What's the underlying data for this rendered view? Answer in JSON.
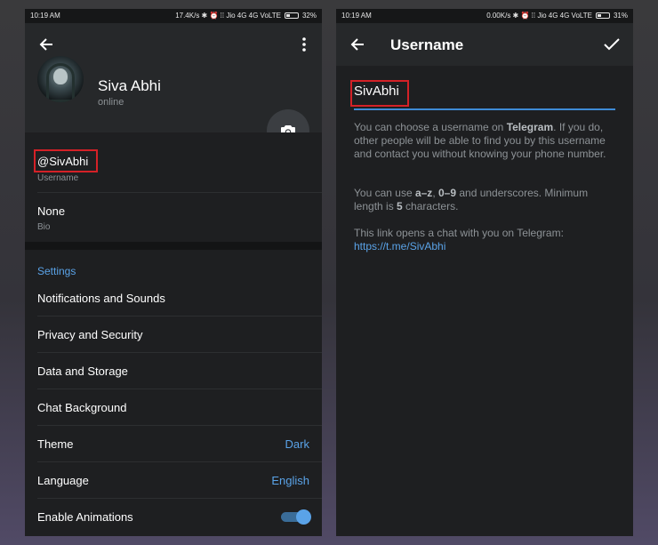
{
  "left": {
    "statusbar": {
      "time": "10:19 AM",
      "right": "17.4K/s ✱ ⏰ ⁞⁞ Jio 4G 4G VoLTE",
      "battery": "32%",
      "battery_level": 0.32
    },
    "profile": {
      "name": "Siva Abhi",
      "status": "online"
    },
    "username": {
      "value": "@SivAbhi",
      "label": "Username"
    },
    "bio": {
      "value": "None",
      "label": "Bio"
    },
    "settings": {
      "header": "Settings",
      "items": [
        {
          "label": "Notifications and Sounds"
        },
        {
          "label": "Privacy and Security"
        },
        {
          "label": "Data and Storage"
        },
        {
          "label": "Chat Background"
        },
        {
          "label": "Theme",
          "value": "Dark"
        },
        {
          "label": "Language",
          "value": "English"
        },
        {
          "label": "Enable Animations",
          "toggle": true
        }
      ]
    },
    "icons": {
      "back": "arrow-left-icon",
      "menu": "more-vert-icon",
      "camera": "camera-icon"
    }
  },
  "right": {
    "statusbar": {
      "time": "10:19 AM",
      "right": "0.00K/s ✱ ⏰ ⁞⁞ Jio 4G 4G VoLTE",
      "battery": "31%",
      "battery_level": 0.31
    },
    "title": "Username",
    "input_value": "SivAbhi",
    "help1_a": "You can choose a username on ",
    "help1_b": "Telegram",
    "help1_c": ". If you do, other people will be able to find you by this username and contact you without knowing your phone number.",
    "help2_a": "You can use ",
    "help2_b": "a–z",
    "help2_c": ", ",
    "help2_d": "0–9",
    "help2_e": " and underscores. Minimum length is ",
    "help2_f": "5",
    "help2_g": " characters.",
    "help3": "This link opens a chat with you on Telegram:",
    "link": "https://t.me/SivAbhi",
    "icons": {
      "back": "arrow-left-icon",
      "done": "check-icon"
    }
  },
  "colors": {
    "accent": "#5aa3e8",
    "highlight": "#d42127",
    "background": "#1e1f21",
    "header": "#26282a"
  }
}
